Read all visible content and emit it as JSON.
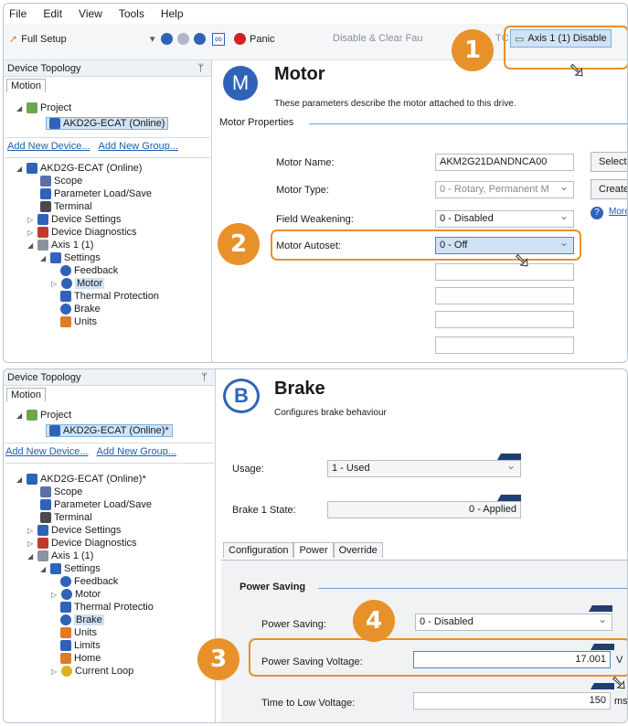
{
  "menu": [
    "File",
    "Edit",
    "View",
    "Tools",
    "Help"
  ],
  "toolbar": {
    "full_setup": "Full Setup",
    "panic": "Panic",
    "disable_clear": "Disable & Clear Fau",
    "axis_disable": "Axis 1 (1) Disable",
    "tc": "TC"
  },
  "top": {
    "tree_title": "Device Topology",
    "tab": "Motion",
    "project": "Project",
    "device_online": "AKD2G-ECAT (Online)",
    "add_device": "Add New Device...",
    "add_group": "Add New Group...",
    "nodes": [
      "AKD2G-ECAT (Online)",
      "Scope",
      "Parameter Load/Save",
      "Terminal",
      "Device Settings",
      "Device Diagnostics",
      "Axis 1 (1)",
      "Settings",
      "Feedback",
      "Motor",
      "Thermal Protection",
      "Brake",
      "Units"
    ],
    "page_icon": "M",
    "page_title": "Motor",
    "page_desc": "These parameters describe the motor attached to this drive.",
    "section": "Motor Properties",
    "fields": [
      {
        "label": "Motor Name:",
        "value": "AKM2G21DANDNCA00"
      },
      {
        "label": "Motor Type:",
        "value": "0 - Rotary, Permanent M"
      },
      {
        "label": "Field Weakening:",
        "value": "0 - Disabled"
      },
      {
        "label": "Motor Autoset:",
        "value": "0 - Off"
      }
    ],
    "btn_select": "Select",
    "btn_create": "Create",
    "more": "More"
  },
  "bottom": {
    "tree_title": "Device Topology",
    "tab": "Motion",
    "project": "Project",
    "device_online": "AKD2G-ECAT (Online)*",
    "add_device": "Add New Device...",
    "add_group": "Add New Group...",
    "nodes": [
      "AKD2G-ECAT (Online)*",
      "Scope",
      "Parameter Load/Save",
      "Terminal",
      "Device Settings",
      "Device Diagnostics",
      "Axis 1 (1)",
      "Settings",
      "Feedback",
      "Motor",
      "Thermal Protectio",
      "Brake",
      "Units",
      "Limits",
      "Home",
      "Current Loop"
    ],
    "page_icon": "B",
    "page_title": "Brake",
    "page_desc": "Configures brake behaviour",
    "usage_label": "Usage:",
    "usage_value": "1 - Used",
    "state_label": "Brake 1 State:",
    "state_value": "0 - Applied",
    "tabs": [
      "Configuration",
      "Power",
      "Override"
    ],
    "section": "Power Saving",
    "ps_label": "Power Saving:",
    "ps_value": "0 - Disabled",
    "psv_label": "Power Saving Voltage:",
    "psv_value": "17.001",
    "psv_unit": "V",
    "tlv_label": "Time to Low Voltage:",
    "tlv_value": "150",
    "tlv_unit": "ms"
  },
  "callouts": [
    "1",
    "2",
    "3",
    "4"
  ],
  "colors": {
    "accent": "#e8912b",
    "selection": "#cfe3f6",
    "icon_blue": "#2f63b8",
    "flag": "#1f3f6e"
  }
}
